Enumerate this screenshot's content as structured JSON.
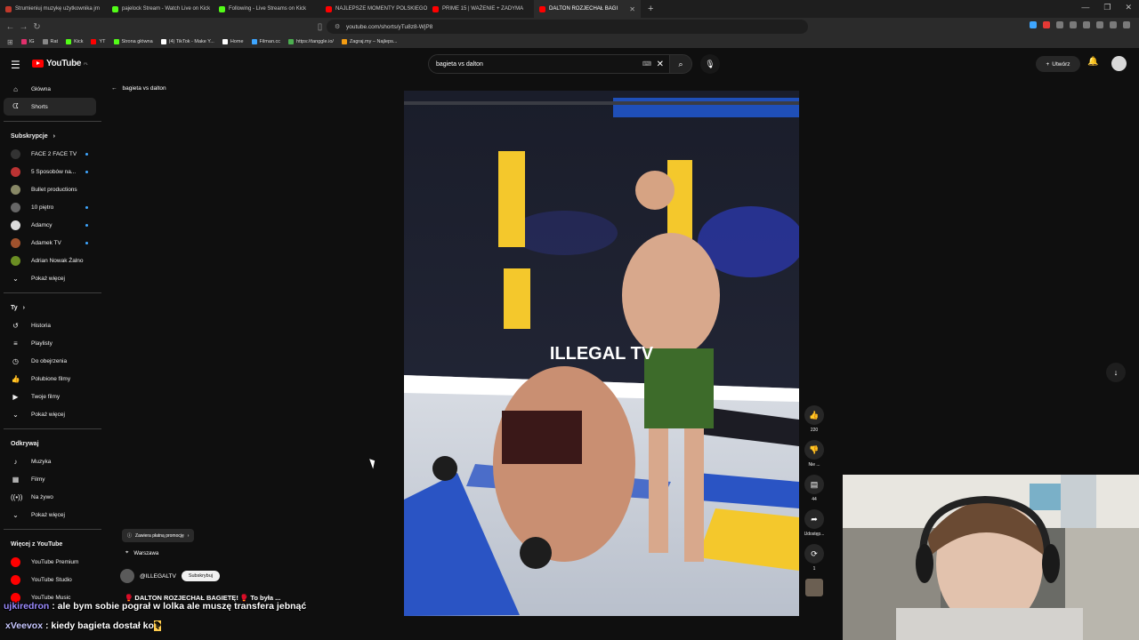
{
  "browser": {
    "tabs": [
      {
        "title": "Strumieniuj muzykę użytkownika jrn",
        "color": "#c0392b"
      },
      {
        "title": "pajelock Stream - Watch Live on Kick",
        "color": "#53fc18"
      },
      {
        "title": "Following - Live Streams on Kick",
        "color": "#53fc18"
      },
      {
        "title": "NAJLEPSZE MOMENTY POLSKIEGO",
        "color": "#ff0000"
      },
      {
        "title": "PRIME 15 | WAŻENIE + ZADYMA",
        "color": "#ff0000"
      },
      {
        "title": "DALTON ROZJECHAŁ BAGI",
        "color": "#ff0000"
      }
    ],
    "new_tab": "+",
    "url": "youtube.com/shorts/yTu8z8-WjP8",
    "bookmarks": [
      {
        "label": "IG",
        "color": "#e1306c"
      },
      {
        "label": "Rat",
        "color": "#888888"
      },
      {
        "label": "Kick",
        "color": "#53fc18"
      },
      {
        "label": "YT",
        "color": "#ff0000"
      },
      {
        "label": "Strona główna",
        "color": "#53fc18"
      },
      {
        "label": "(4) TikTok - Make Y...",
        "color": "#ffffff"
      },
      {
        "label": "Home",
        "color": "#ffffff"
      },
      {
        "label": "Filman.cc",
        "color": "#3ea6ff"
      },
      {
        "label": "https://tanggle.io/",
        "color": "#4caf50"
      },
      {
        "label": "Zagraj.my – Najleps...",
        "color": "#f39c12"
      }
    ]
  },
  "header": {
    "logo_text": "YouTube",
    "logo_region": "PL",
    "search_query": "bagieta vs dalton",
    "create_label": "Utwórz"
  },
  "sidebar": {
    "main": [
      {
        "label": "Główna",
        "icon": "home-icon"
      },
      {
        "label": "Shorts",
        "icon": "shorts-icon"
      }
    ],
    "subs_title": "Subskrypcje",
    "subs": [
      {
        "label": "FACE 2 FACE TV",
        "color": "#333333",
        "live": true
      },
      {
        "label": "5 Sposobów na...",
        "color": "#b33",
        "live": true
      },
      {
        "label": "Bullet productions",
        "color": "#888866",
        "live": false
      },
      {
        "label": "10 piętro",
        "color": "#666666",
        "live": true
      },
      {
        "label": "Adamcy",
        "color": "#dddddd",
        "live": true
      },
      {
        "label": "Adamek TV",
        "color": "#a0522d",
        "live": true
      },
      {
        "label": "Adrian Nowak Żalno",
        "color": "#6b8e23",
        "live": false
      }
    ],
    "show_more": "Pokaż więcej",
    "you_title": "Ty",
    "you": [
      {
        "label": "Historia",
        "icon": "history-icon"
      },
      {
        "label": "Playlisty",
        "icon": "playlist-icon"
      },
      {
        "label": "Do obejrzenia",
        "icon": "clock-icon"
      },
      {
        "label": "Polubione filmy",
        "icon": "like-icon"
      },
      {
        "label": "Twoje filmy",
        "icon": "video-icon"
      }
    ],
    "explore_title": "Odkrywaj",
    "explore": [
      {
        "label": "Muzyka",
        "icon": "music-icon"
      },
      {
        "label": "Filmy",
        "icon": "film-icon"
      },
      {
        "label": "Na żywo",
        "icon": "live-icon"
      }
    ],
    "more_title": "Więcej z YouTube",
    "more": [
      {
        "label": "YouTube Premium"
      },
      {
        "label": "YouTube Studio"
      },
      {
        "label": "YouTube Music"
      }
    ]
  },
  "short": {
    "back_label": "bagieta vs dalton",
    "overlay_text": "ILLEGAL TV",
    "promo_label": "Zawiera płatną promocję",
    "location": "Warszawa",
    "channel": "@ILLEGALTV",
    "subscribe_label": "Subskrybuj",
    "title": "🥊 DALTON ROZJECHAŁ BAGIETĘ! 🥊 To była ...",
    "likes": "220",
    "dislike_label": "Nie ...",
    "comments": "44",
    "share_label": "Udostęp...",
    "remix_count": "1"
  },
  "stream_chat": [
    {
      "user": "ujkiredron",
      "text": " : ale bym sobie pograł w lolka ale muszę transfera jebnąć"
    },
    {
      "user": "xVeevox",
      "text": " : kiedy bagieta dostał ko",
      "emote": "?"
    }
  ]
}
